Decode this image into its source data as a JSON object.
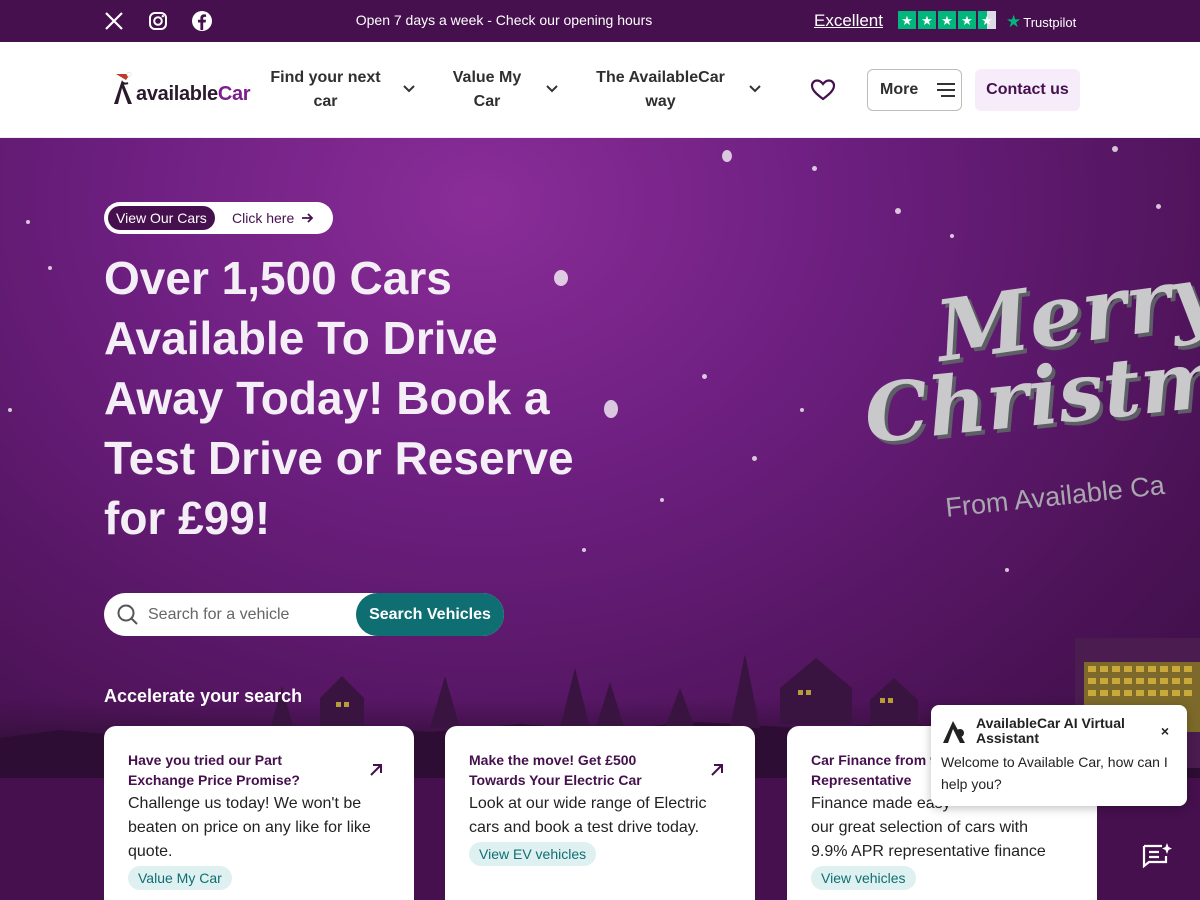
{
  "topbar": {
    "message": "Open 7 days a week - Check our opening hours",
    "rating_label": "Excellent",
    "trustpilot": "Trustpilot",
    "social_icons": [
      "x-icon",
      "instagram-icon",
      "facebook-icon"
    ]
  },
  "header": {
    "logo_prefix": "available",
    "logo_suffix": "Car",
    "nav": [
      {
        "label": "Find your next car"
      },
      {
        "label": "Value My Car"
      },
      {
        "label": "The AvailableCar way"
      }
    ],
    "more_label": "More",
    "contact_label": "Contact us"
  },
  "hero": {
    "pill_tag": "View Our Cars",
    "pill_link": "Click here",
    "headline": "Over 1,500 Cars Available To Drive Away Today! Book a Test Drive or Reserve for £99!",
    "search_placeholder": "Search for a vehicle",
    "search_button": "Search Vehicles",
    "accelerate_heading": "Accelerate your search",
    "xmas_line1": "Merry",
    "xmas_line2": "Christmas",
    "xmas_line3": "From Available Ca"
  },
  "cards": [
    {
      "title": "Have you tried our Part Exchange Price Promise?",
      "body": "Challenge us today! We won't be beaten on price on any like for like quote.",
      "link": "Value My Car"
    },
    {
      "title": "Make the move! Get £500 Towards Your Electric Car",
      "body": "Look at our wide range of Electric cars and book a test drive today.",
      "link": "View EV vehicles"
    },
    {
      "title": "Car Finance from 9",
      "title_line2": "Representative",
      "body": "Finance made easy",
      "body2": "our great selection of cars with 9.9% APR representative finance",
      "link": "View vehicles"
    }
  ],
  "chat": {
    "title": "AvailableCar AI Virtual Assistant",
    "close": "×",
    "message": "Welcome to Available Car, how can I help you?"
  },
  "colors": {
    "brand_purple": "#45104d",
    "teal": "#0f6e72",
    "trustpilot_green": "#00b67a"
  }
}
